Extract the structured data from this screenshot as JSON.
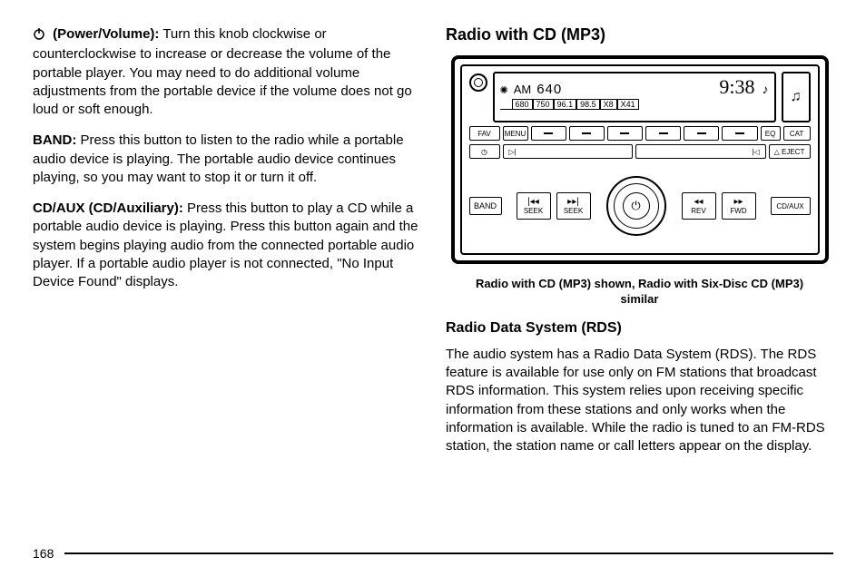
{
  "page_number": "168",
  "left": {
    "p1": {
      "icon": "power-icon",
      "term": "(Power/Volume):",
      "text": "Turn this knob clockwise or counterclockwise to increase or decrease the volume of the portable player. You may need to do additional volume adjustments from the portable device if the volume does not go loud or soft enough."
    },
    "p2": {
      "term": "BAND:",
      "text": "Press this button to listen to the radio while a portable audio device is playing. The portable audio device continues playing, so you may want to stop it or turn it off."
    },
    "p3": {
      "term": "CD/AUX (CD/Auxiliary):",
      "text": "Press this button to play a CD while a portable audio device is playing. Press this button again and the system begins playing audio from the connected portable audio player. If a portable audio player is not connected, \"No Input Device Found\" displays."
    }
  },
  "right": {
    "h2": "Radio with CD (MP3)",
    "caption": "Radio with CD (MP3) shown, Radio with Six-Disc CD (MP3) similar",
    "h3": "Radio Data System (RDS)",
    "rds_text": "The audio system has a Radio Data System (RDS). The RDS feature is available for use only on FM stations that broadcast RDS information. This system relies upon receiving specific information from these stations and only works when the information is available. While the radio is tuned to an FM-RDS station, the station name or call letters appear on the display."
  },
  "radio": {
    "band": "AM",
    "freq": "640",
    "clock": "9:38",
    "presets": [
      "680",
      "750",
      "96.1",
      "98.5",
      "X8",
      "X41"
    ],
    "note": "♫",
    "bell": "♫",
    "row1": {
      "fav": "FAV",
      "menu": "MENU",
      "eq": "EQ",
      "cat": "CAT"
    },
    "row2": {
      "clock_icon": "◷",
      "prev": "▻|",
      "next": "|◅",
      "eject": "△ EJECT"
    },
    "ctrl": {
      "band": "BAND",
      "seek_back": {
        "sym": "|◂◂",
        "label": "SEEK"
      },
      "seek_fwd": {
        "sym": "▸▸|",
        "label": "SEEK"
      },
      "power": "⏻",
      "rev": {
        "sym": "◂◂",
        "label": "REV"
      },
      "fwd": {
        "sym": "▸▸",
        "label": "FWD"
      },
      "cdaux": "CD/AUX"
    }
  }
}
